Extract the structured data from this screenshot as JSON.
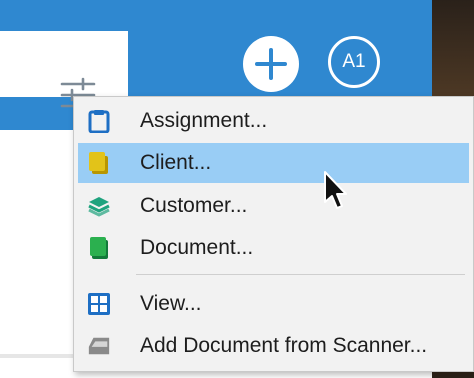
{
  "header": {
    "filter_icon": "sliders-icon",
    "add_icon": "plus-icon",
    "avatar_initials": "A1",
    "accent_color": "#2f88d0"
  },
  "menu": {
    "highlight_color": "#99cdf5",
    "items": [
      {
        "label": "Assignment...",
        "icon": "clipboard-icon"
      },
      {
        "label": "Client...",
        "icon": "client-folder-icon"
      },
      {
        "label": "Customer...",
        "icon": "layers-icon"
      },
      {
        "label": "Document...",
        "icon": "document-book-icon"
      },
      {
        "label": "View...",
        "icon": "grid-view-icon"
      },
      {
        "label": "Add Document from Scanner...",
        "icon": "scanner-icon"
      }
    ],
    "highlighted_index": 1
  }
}
